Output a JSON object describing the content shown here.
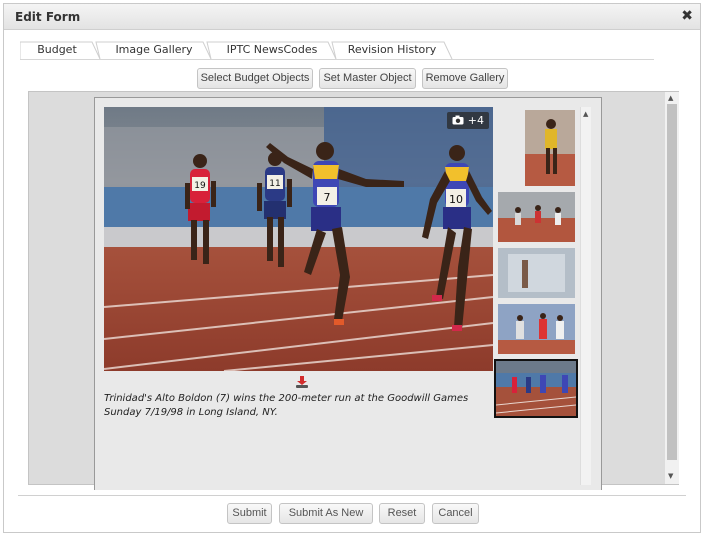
{
  "dialog": {
    "title": "Edit Form",
    "close_glyph": "✖"
  },
  "tabs": [
    {
      "label": "Budget"
    },
    {
      "label": "Image Gallery"
    },
    {
      "label": "IPTC NewsCodes"
    },
    {
      "label": "Revision History"
    }
  ],
  "toolbar": {
    "select_budget_label": "Select Budget Objects",
    "set_master_label": "Set Master Object",
    "remove_gallery_label": "Remove Gallery"
  },
  "gallery": {
    "photo_count_badge": "+4",
    "camera_icon": "camera-icon",
    "caption": "Trinidad's Alto Boldon (7) wins the 200-meter run at the Goodwill Games Sunday 7/19/98 in Long Island, NY.",
    "bib_numbers": [
      "19",
      "11",
      "7",
      "10"
    ],
    "selected_thumbnail": 5
  },
  "footer": {
    "submit_label": "Submit",
    "submit_new_label": "Submit As New",
    "reset_label": "Reset",
    "cancel_label": "Cancel"
  }
}
